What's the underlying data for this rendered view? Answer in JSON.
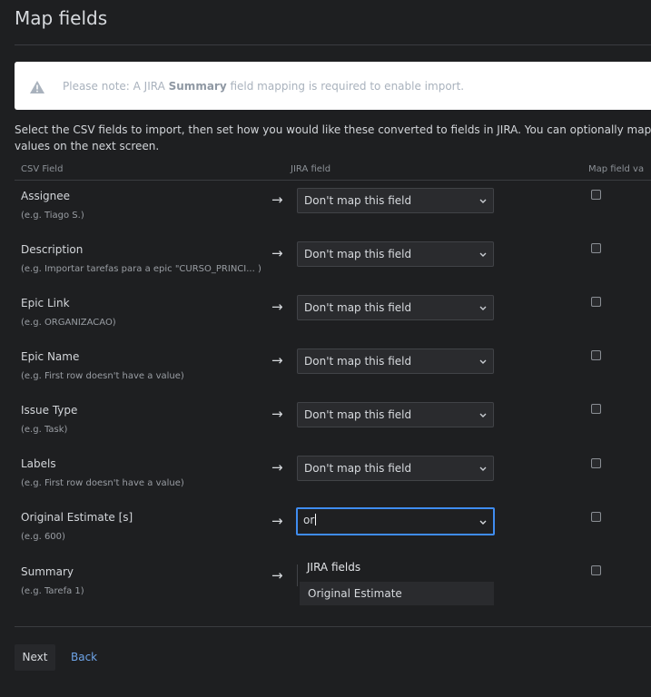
{
  "page": {
    "title": "Map fields"
  },
  "notice": {
    "prefix": "Please note: A JIRA ",
    "bold": "Summary",
    "suffix": " field mapping is required to enable import."
  },
  "intro": {
    "line1": "Select the CSV fields to import, then set how you would like these converted to fields in JIRA. You can optionally map fie",
    "line2": "values on the next screen."
  },
  "table": {
    "headers": {
      "csv": "CSV Field",
      "jira": "JIRA field",
      "map": "Map field va"
    },
    "rows": [
      {
        "label": "Assignee",
        "example": "(e.g. Tiago S.)",
        "value": "Don't map this field"
      },
      {
        "label": "Description",
        "example": "(e.g. Importar tarefas para a epic \"CURSO_PRINCI... )",
        "value": "Don't map this field"
      },
      {
        "label": "Epic Link",
        "example": "(e.g. ORGANIZACAO)",
        "value": "Don't map this field"
      },
      {
        "label": "Epic Name",
        "example": "(e.g. First row doesn't have a value)",
        "value": "Don't map this field"
      },
      {
        "label": "Issue Type",
        "example": "(e.g. Task)",
        "value": "Don't map this field"
      },
      {
        "label": "Labels",
        "example": "(e.g. First row doesn't have a value)",
        "value": "Don't map this field"
      },
      {
        "label": "Original Estimate [s]",
        "example": "(e.g. 600)",
        "value": "or"
      },
      {
        "label": "Summary",
        "example": "(e.g. Tarefa 1)",
        "value": ""
      }
    ],
    "arrow": "→"
  },
  "dropdown": {
    "group": "JIRA fields",
    "option": "Original Estimate"
  },
  "footer": {
    "next": "Next",
    "back": "Back"
  }
}
